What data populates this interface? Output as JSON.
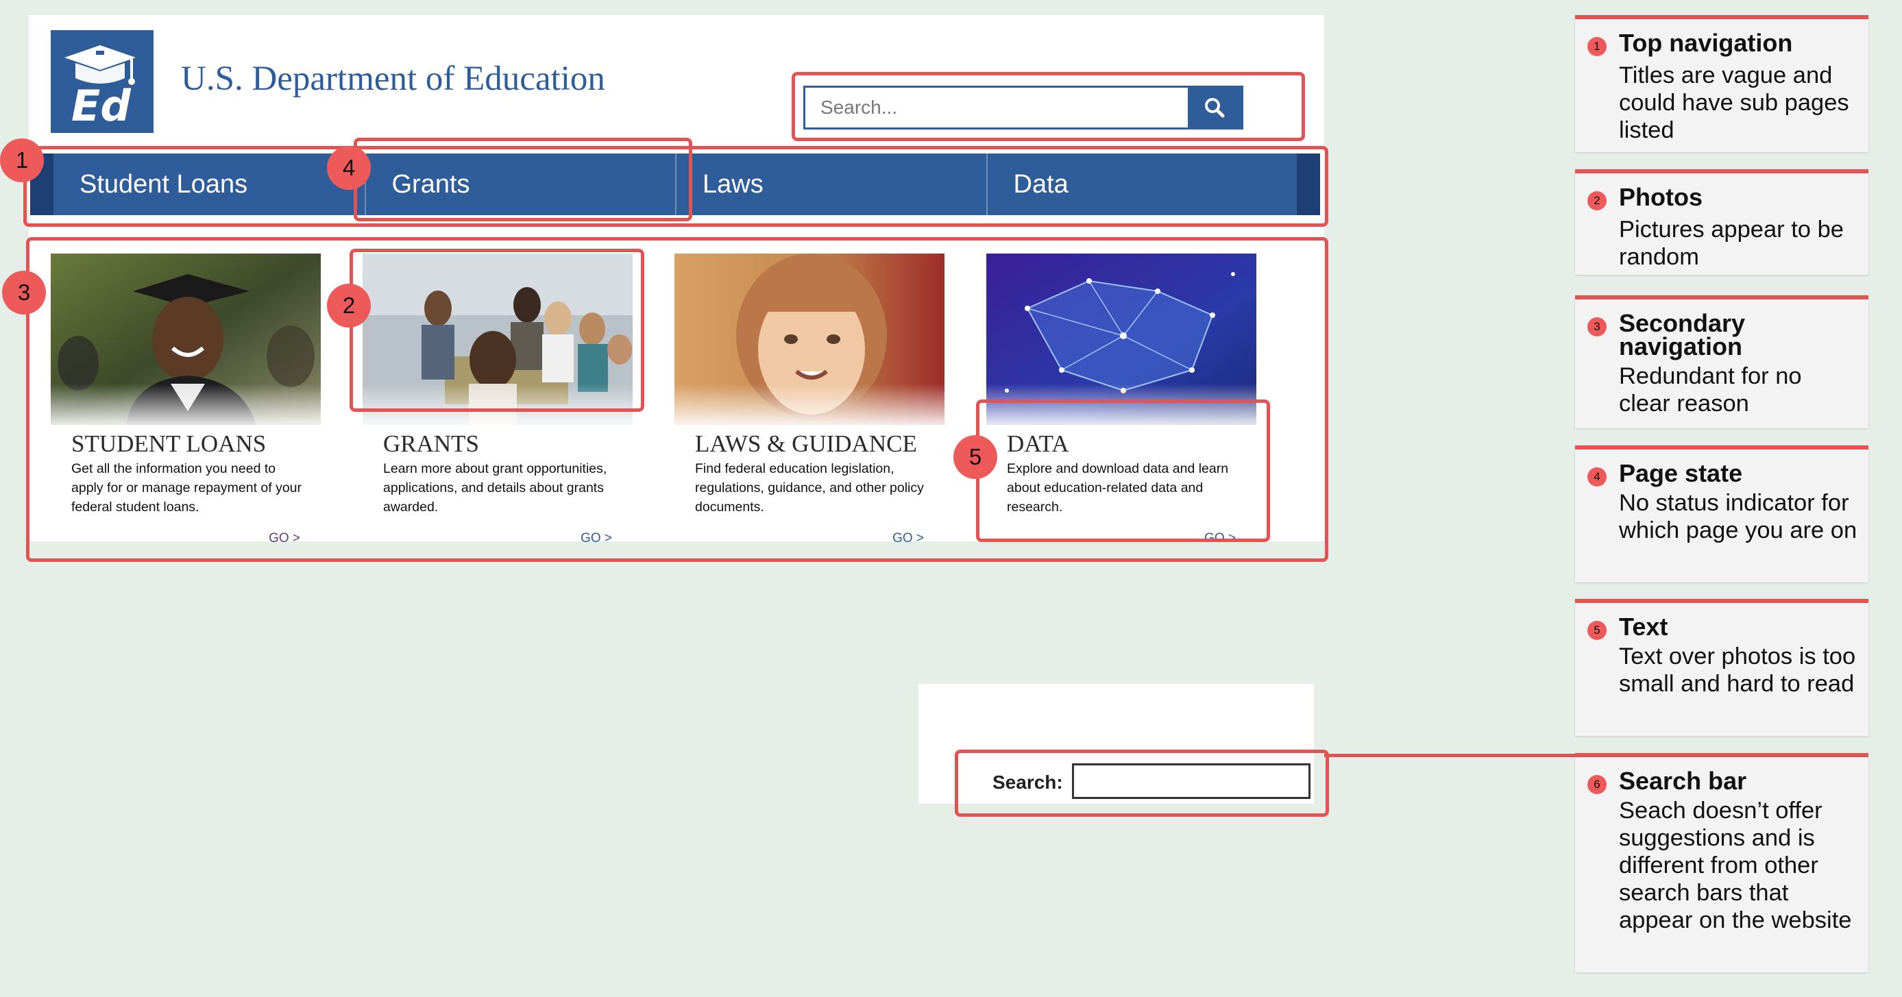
{
  "site": {
    "title": "U.S. Department of Education",
    "logo_icon": "ed-graduation-cap-logo",
    "search_placeholder": "Search...",
    "search_icon": "search-icon",
    "nav": [
      "Student Loans",
      "Grants",
      "Laws",
      "Data"
    ],
    "cards": [
      {
        "title": "STUDENT LOANS",
        "desc": "Get all the information you need to apply for or manage repayment of your federal student loans.",
        "go": "GO >"
      },
      {
        "title": "GRANTS",
        "desc": "Learn more about grant opportunities, applications, and details about grants awarded.",
        "go": "GO >"
      },
      {
        "title": "LAWS & GUIDANCE",
        "desc": "Find federal education legislation, regulations, guidance, and other policy documents.",
        "go": "GO >"
      },
      {
        "title": "DATA",
        "desc": "Explore and download data and learn about education-related data and research.",
        "go": "GO >"
      }
    ]
  },
  "snippet": {
    "label": "Search:"
  },
  "callouts": [
    "1",
    "2",
    "3",
    "4",
    "5"
  ],
  "notes": [
    {
      "num": "1",
      "title": "Top navigation",
      "body": "Titles are vague and could have sub pages listed"
    },
    {
      "num": "2",
      "title": "Photos",
      "body": "Pictures appear to be random"
    },
    {
      "num": "3",
      "title": "Secondary navigation",
      "body": "Redundant for no clear reason"
    },
    {
      "num": "4",
      "title": "Page state",
      "body": "No status indicator for which page you are on"
    },
    {
      "num": "5",
      "title": "Text",
      "body": "Text over photos is too small and hard to read"
    },
    {
      "num": "6",
      "title": "Search bar",
      "body": "Seach doesn’t offer suggestions and is different from other search bars that appear on the website"
    }
  ],
  "colors": {
    "brand_blue": "#2e5d9a",
    "annotation_red": "#e35353",
    "background": "#e5efe8"
  }
}
